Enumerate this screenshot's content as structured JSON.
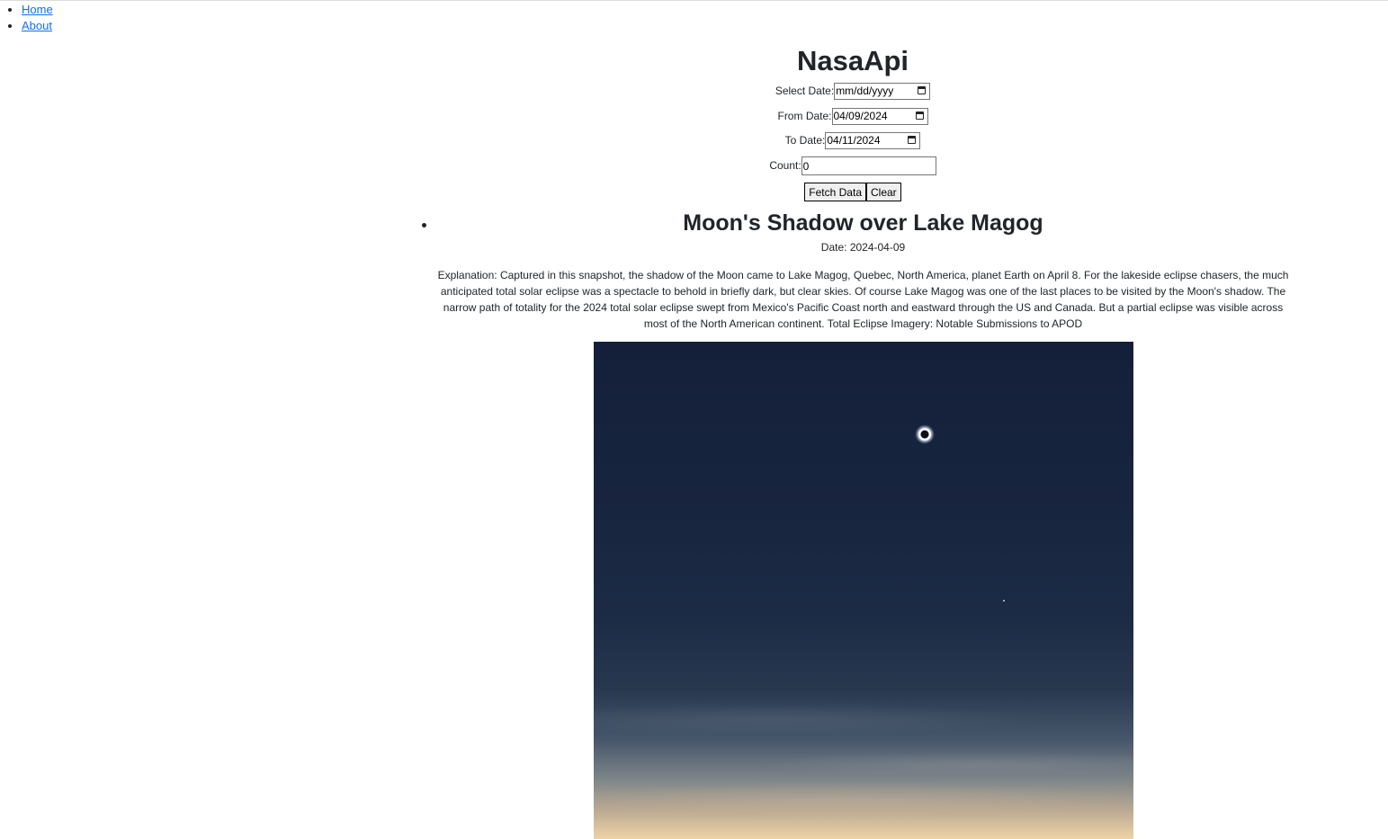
{
  "nav": {
    "items": [
      {
        "label": "Home"
      },
      {
        "label": "About"
      }
    ]
  },
  "app": {
    "title": "NasaApi"
  },
  "form": {
    "select_date": {
      "label": "Select Date:",
      "value": "mm/dd/yyyy"
    },
    "from_date": {
      "label": "From Date:",
      "value": "04/09/2024"
    },
    "to_date": {
      "label": "To Date:",
      "value": "04/11/2024"
    },
    "count": {
      "label": "Count:",
      "value": "0"
    },
    "fetch_label": "Fetch Data",
    "clear_label": "Clear"
  },
  "results": [
    {
      "title": "Moon's Shadow over Lake Magog",
      "date_text": "Date: 2024-04-09",
      "explanation": "Explanation: Captured in this snapshot, the shadow of the Moon came to Lake Magog, Quebec, North America, planet Earth on April 8. For the lakeside eclipse chasers, the much anticipated total solar eclipse was a spectacle to behold in briefly dark, but clear skies. Of course Lake Magog was one of the last places to be visited by the Moon's shadow. The narrow path of totality for the 2024 total solar eclipse swept from Mexico's Pacific Coast north and eastward through the US and Canada. But a partial eclipse was visible across most of the North American continent. Total Eclipse Imagery: Notable Submissions to APOD"
    }
  ],
  "icons": {
    "date_picker": "calendar-icon",
    "list_marker": "bullet"
  },
  "colors": {
    "link": "#0d6efd",
    "text": "#212529",
    "button_bg": "#efefef"
  }
}
